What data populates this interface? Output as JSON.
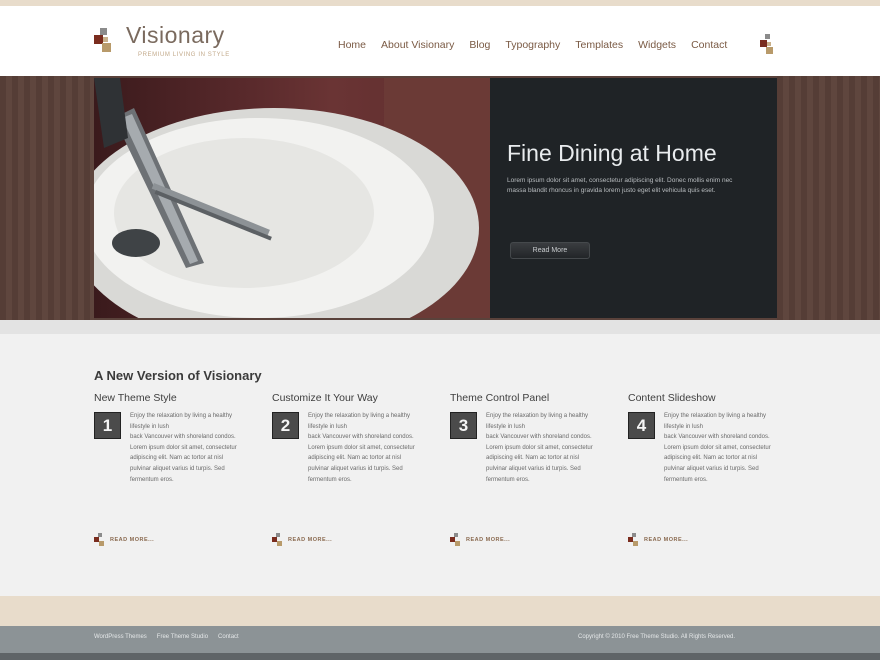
{
  "site": {
    "logo_title": "Visionary",
    "logo_tagline": "PREMIUM LIVING IN STYLE",
    "logo_icon": "tile-cluster-icon"
  },
  "nav": {
    "items": [
      {
        "label": "Home"
      },
      {
        "label": "About Visionary"
      },
      {
        "label": "Blog"
      },
      {
        "label": "Typography"
      },
      {
        "label": "Templates"
      },
      {
        "label": "Widgets"
      },
      {
        "label": "Contact"
      }
    ],
    "icon": "tile-cluster-icon"
  },
  "hero": {
    "title": "Fine Dining at Home",
    "text": "Lorem ipsum dolor sit amet, consectetur adipiscing elit. Donec mollis enim nec massa blandit rhoncus in gravida lorem justo eget elit vehicula quis eset.",
    "button_label": "Read More"
  },
  "main": {
    "section_title": "A New Version of Visionary",
    "features": [
      {
        "title": "New Theme Style",
        "number": "1",
        "text_lead": "Enjoy the relaxation by living a healthy lifestyle in lush",
        "text_body": "back Vancouver with shoreland condos. Lorem ipsum dolor sit amet, consectetur adipiscing elit. Nam ac tortor at nisl pulvinar aliquet varius id turpis. Sed fermentum eros.",
        "read_more": "READ MORE..."
      },
      {
        "title": "Customize It Your Way",
        "number": "2",
        "text_lead": "Enjoy the relaxation by living a healthy lifestyle in lush",
        "text_body": "back Vancouver with shoreland condos. Lorem ipsum dolor sit amet, consectetur adipiscing elit. Nam ac tortor at nisl pulvinar aliquet varius id turpis. Sed fermentum eros.",
        "read_more": "READ MORE..."
      },
      {
        "title": "Theme Control Panel",
        "number": "3",
        "text_lead": "Enjoy the relaxation by living a healthy lifestyle in lush",
        "text_body": "back Vancouver with shoreland condos. Lorem ipsum dolor sit amet, consectetur adipiscing elit. Nam ac tortor at nisl pulvinar aliquet varius id turpis. Sed fermentum eros.",
        "read_more": "READ MORE..."
      },
      {
        "title": "Content Slideshow",
        "number": "4",
        "text_lead": "Enjoy the relaxation by living a healthy lifestyle in lush",
        "text_body": "back Vancouver with shoreland condos. Lorem ipsum dolor sit amet, consectetur adipiscing elit. Nam ac tortor at nisl pulvinar aliquet varius id turpis. Sed fermentum eros.",
        "read_more": "READ MORE..."
      }
    ]
  },
  "footer": {
    "links": [
      {
        "label": "WordPress Themes"
      },
      {
        "label": "Free Theme Studio"
      },
      {
        "label": "Contact"
      }
    ],
    "copyright": "Copyright © 2010 Free Theme Studio. All Rights Reserved."
  },
  "colors": {
    "accent_brown": "#7a5a44",
    "hero_panel": "#1f2326",
    "content_bg": "#f1f1f1",
    "footer_bg": "#8c9396",
    "band_beige": "#e8dccb"
  }
}
